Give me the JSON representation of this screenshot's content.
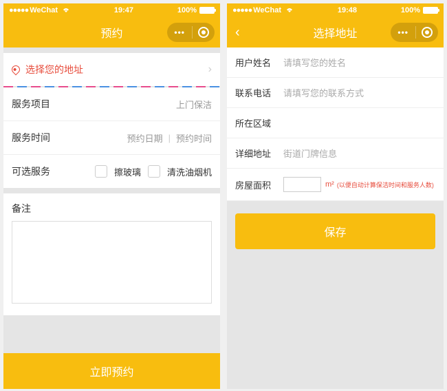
{
  "left": {
    "status": {
      "carrier": "WeChat",
      "time": "19:47",
      "battery": "100%"
    },
    "nav": {
      "title": "预约"
    },
    "address": {
      "select_label": "选择您的地址"
    },
    "form": {
      "service_label": "服务项目",
      "service_value": "上门保洁",
      "time_label": "服务时间",
      "date_value": "预约日期",
      "time_value": "预约时间",
      "options_label": "可选服务",
      "option1": "擦玻璃",
      "option2": "清洗油烟机",
      "remark_label": "备注"
    },
    "submit": "立即预约"
  },
  "right": {
    "status": {
      "carrier": "WeChat",
      "time": "19:48",
      "battery": "100%"
    },
    "nav": {
      "title": "选择地址"
    },
    "fields": {
      "name_label": "用户姓名",
      "name_placeholder": "请填写您的姓名",
      "phone_label": "联系电话",
      "phone_placeholder": "请填写您的联系方式",
      "region_label": "所在区域",
      "detail_label": "详细地址",
      "detail_placeholder": "街道门牌信息",
      "area_label": "房屋面积",
      "area_unit": "m²",
      "area_hint": "(以便自动计算保洁时间和服务人数)"
    },
    "save": "保存"
  }
}
